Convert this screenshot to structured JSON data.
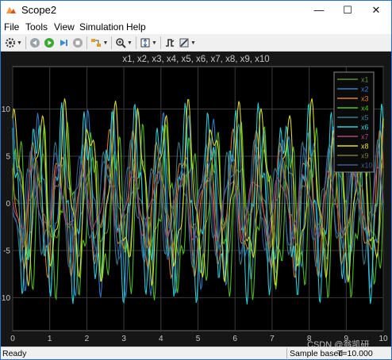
{
  "window": {
    "title": "Scope2",
    "controls": {
      "minimize": "—",
      "maximize": "☐",
      "close": "✕"
    }
  },
  "menu": {
    "items": [
      "File",
      "Tools",
      "View",
      "Simulation",
      "Help"
    ]
  },
  "toolbar": {
    "buttons": [
      {
        "name": "settings-icon",
        "has_dropdown": true
      },
      {
        "name": "step-back-icon",
        "has_dropdown": false
      },
      {
        "name": "run-icon",
        "has_dropdown": false
      },
      {
        "name": "step-forward-icon",
        "has_dropdown": false
      },
      {
        "name": "stop-icon",
        "has_dropdown": false
      },
      {
        "name": "highlight-icon",
        "has_dropdown": true
      },
      {
        "name": "zoom-in-icon",
        "has_dropdown": true
      },
      {
        "name": "autoscale-icon",
        "has_dropdown": true
      },
      {
        "name": "triggers-icon",
        "has_dropdown": false
      },
      {
        "name": "style-icon",
        "has_dropdown": true
      }
    ]
  },
  "status": {
    "ready": "Ready",
    "sample_mode": "Sample based",
    "time": "T=10.000"
  },
  "watermark": "CSDN @翁凯研",
  "chart_data": {
    "type": "line",
    "title": "x1, x2, x3, x4, x5, x6, x7, x8, x9, x10",
    "xlabel": "",
    "ylabel": "",
    "xlim": [
      0,
      10
    ],
    "ylim": [
      -13.5,
      14.5
    ],
    "xticks": [
      0,
      1,
      2,
      3,
      4,
      5,
      6,
      7,
      8,
      9,
      10
    ],
    "yticks": [
      -10,
      -5,
      0,
      5,
      10
    ],
    "grid": true,
    "legend_position": "top-right",
    "background": "#161616",
    "series": [
      {
        "name": "x1",
        "color": "#5e8f2e",
        "amp": 4.5,
        "freq": 1.5,
        "phase": 0.5,
        "amp2": 1.2,
        "freq2": 3.7,
        "offset": 0
      },
      {
        "name": "x2",
        "color": "#2f7fd0",
        "amp": 7.5,
        "freq": 1.5,
        "phase": 1.2,
        "amp2": 2.5,
        "freq2": 4.4,
        "offset": 0
      },
      {
        "name": "x3",
        "color": "#e07e2a",
        "amp": 6.0,
        "freq": 1.5,
        "phase": 2.2,
        "amp2": 2.0,
        "freq2": 3.3,
        "offset": 0
      },
      {
        "name": "x4",
        "color": "#52c41a",
        "amp": 7.0,
        "freq": 1.5,
        "phase": 0.1,
        "amp2": 2.5,
        "freq2": 4.9,
        "offset": -0.8
      },
      {
        "name": "x5",
        "color": "#3a7a8c",
        "amp": 5.0,
        "freq": 1.5,
        "phase": 3.0,
        "amp2": 1.8,
        "freq2": 3.9,
        "offset": 0
      },
      {
        "name": "x6",
        "color": "#2ad4dc",
        "amp": 8.0,
        "freq": 1.5,
        "phase": 1.8,
        "amp2": 2.8,
        "freq2": 5.1,
        "offset": 0
      },
      {
        "name": "x7",
        "color": "#b04478",
        "amp": 3.0,
        "freq": 1.5,
        "phase": 2.7,
        "amp2": 1.0,
        "freq2": 2.9,
        "offset": 0
      },
      {
        "name": "x8",
        "color": "#e2e22a",
        "amp": 7.5,
        "freq": 1.5,
        "phase": 0.8,
        "amp2": 2.5,
        "freq2": 3.6,
        "offset": 1.2
      },
      {
        "name": "x9",
        "color": "#7a7a3a",
        "amp": 3.5,
        "freq": 1.5,
        "phase": 2.0,
        "amp2": 1.2,
        "freq2": 4.2,
        "offset": 0
      },
      {
        "name": "x10",
        "color": "#3a5d92",
        "amp": 4.5,
        "freq": 1.5,
        "phase": 2.9,
        "amp2": 1.5,
        "freq2": 3.1,
        "offset": 0
      }
    ]
  }
}
